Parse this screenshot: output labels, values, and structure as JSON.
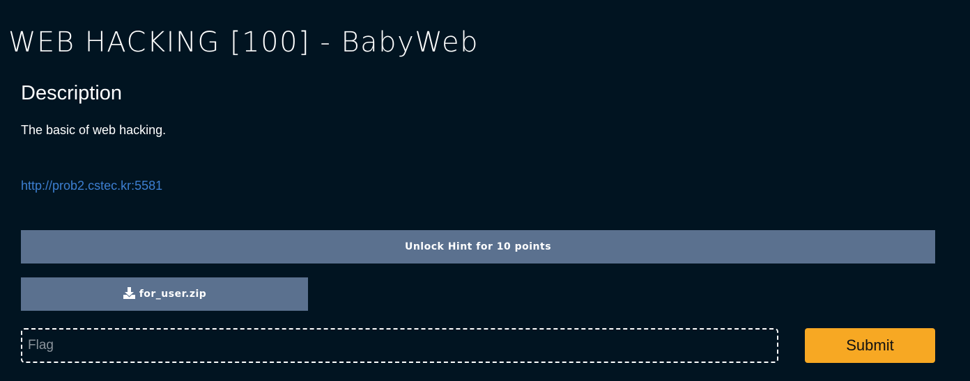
{
  "challenge": {
    "title": "WEB HACKING [100] - BabyWeb",
    "description_heading": "Description",
    "description": "The basic of web hacking.",
    "link": "http://prob2.cstec.kr:5581"
  },
  "hint": {
    "label": "Unlock Hint for 10 points"
  },
  "files": [
    {
      "name": "for_user.zip",
      "icon": "download-icon"
    }
  ],
  "flag_form": {
    "input_value": "",
    "placeholder": "Flag",
    "submit_label": "Submit"
  },
  "colors": {
    "background": "#011421",
    "button": "#5b718f",
    "submit": "#f7a823",
    "link": "#3d7fd1"
  }
}
